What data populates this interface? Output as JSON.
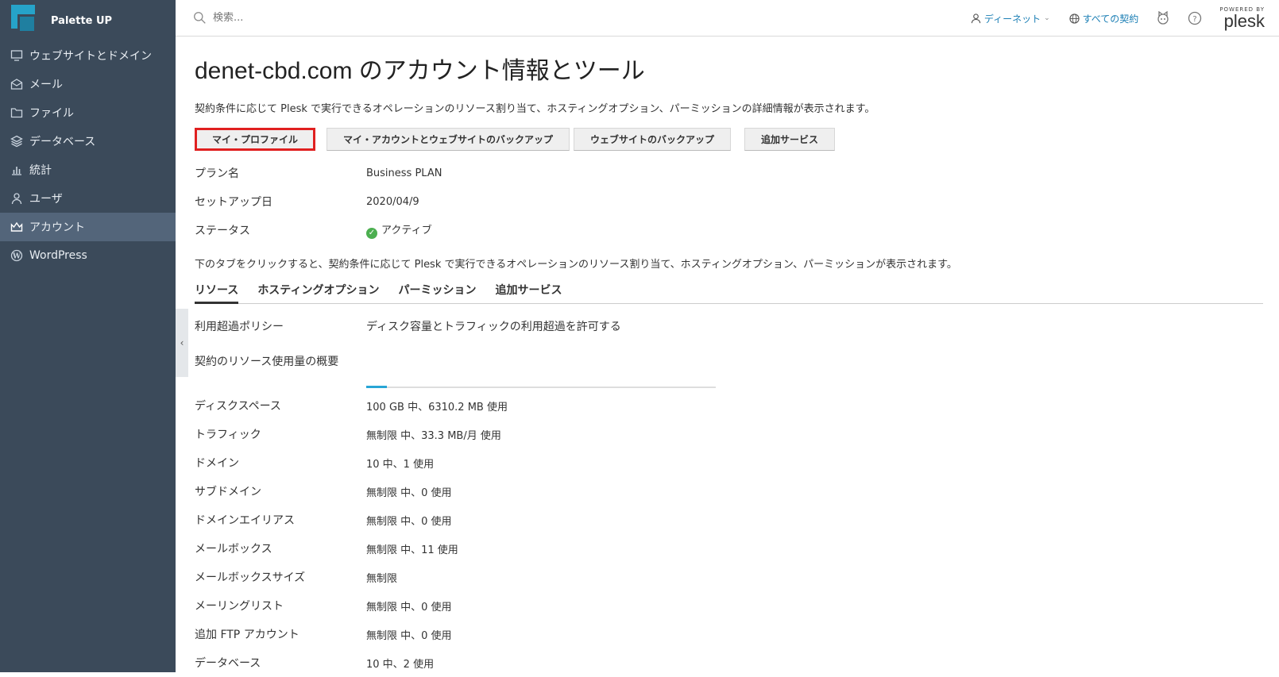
{
  "app": {
    "name": "Palette UP"
  },
  "sidebar": {
    "items": [
      {
        "label": "ウェブサイトとドメイン",
        "icon": "monitor-icon"
      },
      {
        "label": "メール",
        "icon": "mail-icon"
      },
      {
        "label": "ファイル",
        "icon": "folder-icon"
      },
      {
        "label": "データベース",
        "icon": "database-icon"
      },
      {
        "label": "統計",
        "icon": "chart-icon"
      },
      {
        "label": "ユーザ",
        "icon": "user-icon"
      },
      {
        "label": "アカウント",
        "icon": "crown-icon",
        "active": true
      },
      {
        "label": "WordPress",
        "icon": "wordpress-icon"
      }
    ]
  },
  "topbar": {
    "search_placeholder": "検索...",
    "user_label": "ディーネット",
    "subscriptions_label": "すべての契約",
    "powered_by": "POWERED BY",
    "brand": "plesk"
  },
  "page": {
    "title": "denet-cbd.com のアカウント情報とツール",
    "description": "契約条件に応じて Plesk で実行できるオペレーションのリソース割り当て、ホスティングオプション、パーミッションの詳細情報が表示されます。",
    "buttons": [
      "マイ・プロファイル",
      "マイ・アカウントとウェブサイトのバックアップ",
      "ウェブサイトのバックアップ",
      "追加サービス"
    ],
    "info": [
      {
        "key": "プラン名",
        "value": "Business PLAN"
      },
      {
        "key": "セットアップ日",
        "value": "2020/04/9"
      },
      {
        "key": "ステータス",
        "value": "アクティブ"
      }
    ],
    "tabs_description": "下のタブをクリックすると、契約条件に応じて Plesk で実行できるオペレーションのリソース割り当て、ホスティングオプション、パーミッションが表示されます。",
    "tabs": [
      "リソース",
      "ホスティングオプション",
      "パーミッション",
      "追加サービス"
    ],
    "overuse_policy": {
      "key": "利用超過ポリシー",
      "value": "ディスク容量とトラフィックの利用超過を許可する"
    },
    "usage_summary_label": "契約のリソース使用量の概要",
    "usage_fraction": 0.06,
    "resources": [
      {
        "key": "ディスクスペース",
        "value": "100 GB 中、6310.2 MB 使用"
      },
      {
        "key": "トラフィック",
        "value": "無制限 中、33.3 MB/月 使用"
      },
      {
        "key": "ドメイン",
        "value": "10 中、1 使用"
      },
      {
        "key": "サブドメイン",
        "value": "無制限 中、0 使用"
      },
      {
        "key": "ドメインエイリアス",
        "value": "無制限 中、0 使用"
      },
      {
        "key": "メールボックス",
        "value": "無制限 中、11 使用"
      },
      {
        "key": "メールボックスサイズ",
        "value": "無制限"
      },
      {
        "key": "メーリングリスト",
        "value": "無制限 中、0 使用"
      },
      {
        "key": "追加 FTP アカウント",
        "value": "無制限 中、0 使用"
      },
      {
        "key": "データベース",
        "value": "10 中、2 使用"
      }
    ]
  }
}
